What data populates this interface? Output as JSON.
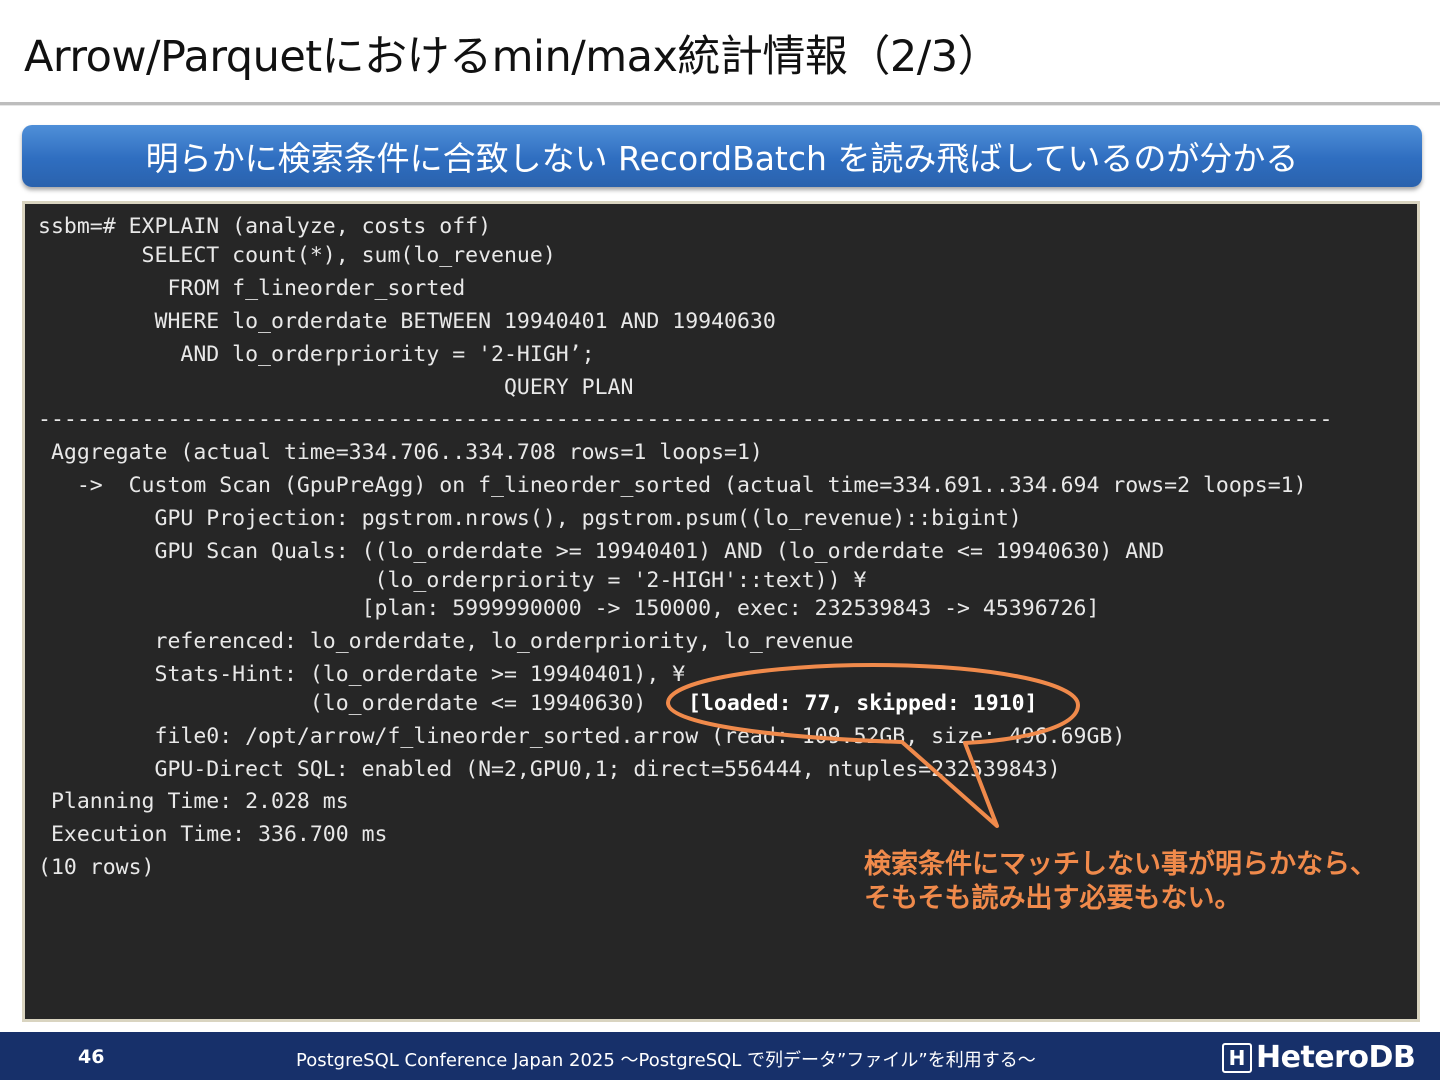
{
  "slide": {
    "title": "Arrow/Parquetにおけるmin/max統計情報（2/3）",
    "banner": "明らかに検索条件に合致しない RecordBatch を読み飛ばしているのが分かる"
  },
  "terminal": {
    "lines": [
      "ssbm=# EXPLAIN (analyze, costs off)",
      "        SELECT count(*), sum(lo_revenue)",
      "          FROM f_lineorder_sorted",
      "         WHERE lo_orderdate BETWEEN 19940401 AND 19940630",
      "           AND lo_orderpriority = '2-HIGH’;",
      "                                    QUERY PLAN",
      "----------------------------------------------------------------------------------------------------",
      " Aggregate (actual time=334.706..334.708 rows=1 loops=1)",
      "   ->  Custom Scan (GpuPreAgg) on f_lineorder_sorted (actual time=334.691..334.694 rows=2 loops=1)",
      "         GPU Projection: pgstrom.nrows(), pgstrom.psum((lo_revenue)::bigint)",
      "         GPU Scan Quals: ((lo_orderdate >= 19940401) AND (lo_orderdate <= 19940630) AND",
      "                          (lo_orderpriority = '2-HIGH'::text)) ¥",
      "                         [plan: 5999990000 -> 150000, exec: 232539843 -> 45396726]",
      "         referenced: lo_orderdate, lo_orderpriority, lo_revenue",
      "         Stats-Hint: (lo_orderdate >= 19940401), ¥",
      "                     (lo_orderdate <= 19940630)  ",
      "         file0: /opt/arrow/f_lineorder_sorted.arrow (read: 109.52GB, size: 496.69GB)",
      "         GPU-Direct SQL: enabled (N=2,GPU0,1; direct=556444, ntuples=232539843)",
      " Planning Time: 2.028 ms",
      " Execution Time: 336.700 ms",
      "(10 rows)"
    ],
    "highlight": "[loaded: 77, skipped: 1910]"
  },
  "callout": {
    "line1": "検索条件にマッチしない事が明らかなら、",
    "line2": "そもそも読み出す必要もない。",
    "color": "#f08a4b"
  },
  "footer": {
    "page_number": "46",
    "conference": "PostgreSQL Conference Japan 2025 ～PostgreSQL で列データ”ファイル”を利用する～",
    "logo_mark": "H",
    "logo_text": "HeteroDB"
  }
}
